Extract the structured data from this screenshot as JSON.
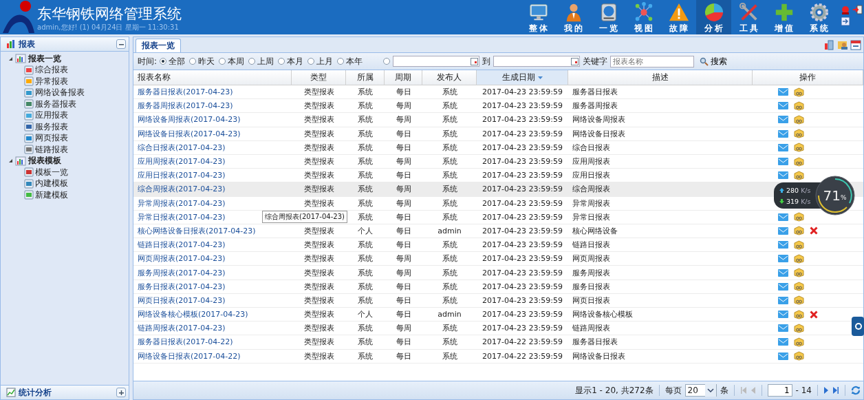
{
  "header": {
    "title": "东华钢铁网络管理系统",
    "status": "admin,您好! (1) 04月24日 星期一 11:30:31"
  },
  "nav": [
    {
      "label": "整体",
      "selected": false
    },
    {
      "label": "我的",
      "selected": false
    },
    {
      "label": "一览",
      "selected": false
    },
    {
      "label": "视图",
      "selected": false
    },
    {
      "label": "故障",
      "selected": false
    },
    {
      "label": "分析",
      "selected": true
    },
    {
      "label": "工具",
      "selected": false
    },
    {
      "label": "增值",
      "selected": false
    },
    {
      "label": "系统",
      "selected": false
    }
  ],
  "sidebar": {
    "title": "报表",
    "tree": [
      {
        "label": "报表一览",
        "expanded": true,
        "children": [
          {
            "label": "综合报表"
          },
          {
            "label": "异常报表"
          },
          {
            "label": "网络设备报表"
          },
          {
            "label": "服务器报表"
          },
          {
            "label": "应用报表"
          },
          {
            "label": "服务报表"
          },
          {
            "label": "网页报表"
          },
          {
            "label": "链路报表"
          }
        ]
      },
      {
        "label": "报表模板",
        "expanded": true,
        "children": [
          {
            "label": "模板一览"
          },
          {
            "label": "内建模板"
          },
          {
            "label": "新建模板"
          }
        ]
      }
    ],
    "bottom_panel": "统计分析"
  },
  "tabs": [
    {
      "label": "报表一览",
      "selected": true
    }
  ],
  "filter": {
    "label": "时间:",
    "options": [
      {
        "label": "全部",
        "selected": true
      },
      {
        "label": "昨天",
        "selected": false
      },
      {
        "label": "本周",
        "selected": false
      },
      {
        "label": "上周",
        "selected": false
      },
      {
        "label": "本月",
        "selected": false
      },
      {
        "label": "上月",
        "selected": false
      },
      {
        "label": "本年",
        "selected": false
      }
    ],
    "custom_range_selected": false,
    "to_label": "到",
    "keyword_label": "关键字",
    "keyword_placeholder": "报表名称",
    "search_button": "搜索"
  },
  "table": {
    "columns": [
      {
        "label": "报表名称",
        "sorted": false
      },
      {
        "label": "类型",
        "sorted": false
      },
      {
        "label": "所属",
        "sorted": false
      },
      {
        "label": "周期",
        "sorted": false
      },
      {
        "label": "发布人",
        "sorted": false
      },
      {
        "label": "生成日期",
        "sorted": true
      },
      {
        "label": "描述",
        "sorted": false
      },
      {
        "label": "操作",
        "sorted": false
      }
    ],
    "rows": [
      {
        "name": "服务器日报表(2017-04-23)",
        "type": "类型报表",
        "owner": "系统",
        "period": "每日",
        "publisher": "系统",
        "date": "2017-04-23 23:59:59",
        "desc": "服务器日报表",
        "highlighted": false,
        "deletable": false
      },
      {
        "name": "服务器周报表(2017-04-23)",
        "type": "类型报表",
        "owner": "系统",
        "period": "每周",
        "publisher": "系统",
        "date": "2017-04-23 23:59:59",
        "desc": "服务器周报表",
        "highlighted": false,
        "deletable": false
      },
      {
        "name": "网络设备周报表(2017-04-23)",
        "type": "类型报表",
        "owner": "系统",
        "period": "每周",
        "publisher": "系统",
        "date": "2017-04-23 23:59:59",
        "desc": "网络设备周报表",
        "highlighted": false,
        "deletable": false
      },
      {
        "name": "网络设备日报表(2017-04-23)",
        "type": "类型报表",
        "owner": "系统",
        "period": "每日",
        "publisher": "系统",
        "date": "2017-04-23 23:59:59",
        "desc": "网络设备日报表",
        "highlighted": false,
        "deletable": false
      },
      {
        "name": "综合日报表(2017-04-23)",
        "type": "类型报表",
        "owner": "系统",
        "period": "每日",
        "publisher": "系统",
        "date": "2017-04-23 23:59:59",
        "desc": "综合日报表",
        "highlighted": false,
        "deletable": false
      },
      {
        "name": "应用周报表(2017-04-23)",
        "type": "类型报表",
        "owner": "系统",
        "period": "每周",
        "publisher": "系统",
        "date": "2017-04-23 23:59:59",
        "desc": "应用周报表",
        "highlighted": false,
        "deletable": false
      },
      {
        "name": "应用日报表(2017-04-23)",
        "type": "类型报表",
        "owner": "系统",
        "period": "每日",
        "publisher": "系统",
        "date": "2017-04-23 23:59:59",
        "desc": "应用日报表",
        "highlighted": false,
        "deletable": false
      },
      {
        "name": "综合周报表(2017-04-23)",
        "type": "类型报表",
        "owner": "系统",
        "period": "每周",
        "publisher": "系统",
        "date": "2017-04-23 23:59:59",
        "desc": "综合周报表",
        "highlighted": true,
        "deletable": false,
        "actions_covered": true
      },
      {
        "name": "异常周报表(2017-04-23)",
        "type": "类型报表",
        "owner": "系统",
        "period": "每周",
        "publisher": "系统",
        "date": "2017-04-23 23:59:59",
        "desc": "异常周报表",
        "highlighted": false,
        "deletable": false,
        "actions_covered": true
      },
      {
        "name": "异常日报表(2017-04-23)",
        "owner": "系统",
        "period": "每日",
        "publisher": "系统",
        "date": "2017-04-23 23:59:59",
        "desc": "异常日报表",
        "highlighted": false,
        "deletable": false
      },
      {
        "name": "核心网络设备日报表(2017-04-23)",
        "type": "类型报表",
        "owner": "个人",
        "period": "每日",
        "publisher": "admin",
        "date": "2017-04-23 23:59:59",
        "desc": "核心网络设备",
        "highlighted": false,
        "deletable": true
      },
      {
        "name": "链路日报表(2017-04-23)",
        "type": "类型报表",
        "owner": "系统",
        "period": "每日",
        "publisher": "系统",
        "date": "2017-04-23 23:59:59",
        "desc": "链路日报表",
        "highlighted": false,
        "deletable": false
      },
      {
        "name": "网页周报表(2017-04-23)",
        "type": "类型报表",
        "owner": "系统",
        "period": "每周",
        "publisher": "系统",
        "date": "2017-04-23 23:59:59",
        "desc": "网页周报表",
        "highlighted": false,
        "deletable": false
      },
      {
        "name": "服务周报表(2017-04-23)",
        "type": "类型报表",
        "owner": "系统",
        "period": "每周",
        "publisher": "系统",
        "date": "2017-04-23 23:59:59",
        "desc": "服务周报表",
        "highlighted": false,
        "deletable": false
      },
      {
        "name": "服务日报表(2017-04-23)",
        "type": "类型报表",
        "owner": "系统",
        "period": "每日",
        "publisher": "系统",
        "date": "2017-04-23 23:59:59",
        "desc": "服务日报表",
        "highlighted": false,
        "deletable": false
      },
      {
        "name": "网页日报表(2017-04-23)",
        "type": "类型报表",
        "owner": "系统",
        "period": "每日",
        "publisher": "系统",
        "date": "2017-04-23 23:59:59",
        "desc": "网页日报表",
        "highlighted": false,
        "deletable": false
      },
      {
        "name": "网络设备核心模板(2017-04-23)",
        "type": "类型报表",
        "owner": "个人",
        "period": "每日",
        "publisher": "admin",
        "date": "2017-04-23 23:59:59",
        "desc": "网络设备核心模板",
        "highlighted": false,
        "deletable": true
      },
      {
        "name": "链路周报表(2017-04-23)",
        "type": "类型报表",
        "owner": "系统",
        "period": "每周",
        "publisher": "系统",
        "date": "2017-04-23 23:59:59",
        "desc": "链路周报表",
        "highlighted": false,
        "deletable": false
      },
      {
        "name": "服务器日报表(2017-04-22)",
        "type": "类型报表",
        "owner": "系统",
        "period": "每日",
        "publisher": "系统",
        "date": "2017-04-22 23:59:59",
        "desc": "服务器日报表",
        "highlighted": false,
        "deletable": false
      },
      {
        "name": "网络设备日报表(2017-04-22)",
        "type": "类型报表",
        "owner": "系统",
        "period": "每日",
        "publisher": "系统",
        "date": "2017-04-22 23:59:59",
        "desc": "网络设备日报表",
        "highlighted": false,
        "deletable": false
      }
    ]
  },
  "tooltip": "综合周报表(2017-04-23)",
  "pager": {
    "summary": "显示1 - 20, 共272条",
    "per_page_label": "每页",
    "per_page": "20",
    "unit": "条",
    "page": "1",
    "total_pages": "- 14"
  },
  "speed_widget": {
    "upload": "280",
    "upload_unit": "K/s",
    "download": "319",
    "download_unit": "K/s",
    "percent": "71",
    "percent_sign": "%"
  }
}
